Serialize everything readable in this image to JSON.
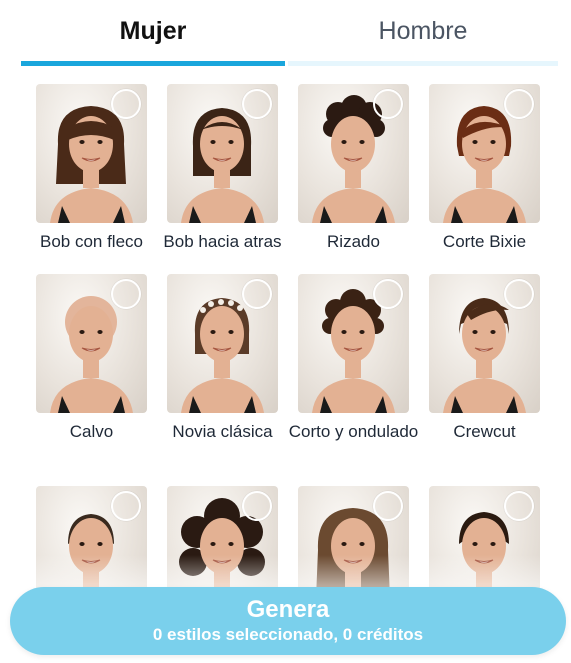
{
  "tabs": {
    "women": "Mujer",
    "men": "Hombre",
    "active": "women"
  },
  "styles": [
    {
      "label": "Bob con fleco",
      "icon": "bob-bangs-portrait",
      "hair": "#4a2a18",
      "selected": false
    },
    {
      "label": "Bob hacia atras",
      "icon": "slicked-bob-portrait",
      "hair": "#3b2416",
      "selected": false
    },
    {
      "label": "Rizado",
      "icon": "curly-portrait",
      "hair": "#2b1a12",
      "selected": false
    },
    {
      "label": "Corte Bixie",
      "icon": "bixie-portrait",
      "hair": "#6b2d14",
      "selected": false
    },
    {
      "label": "Calvo",
      "icon": "bald-portrait",
      "hair": "#e3b59b",
      "selected": false
    },
    {
      "label": "Novia clásica",
      "icon": "bridal-portrait",
      "hair": "#5a3b28",
      "selected": false
    },
    {
      "label": "Corto y ondulado",
      "icon": "short-wavy-portrait",
      "hair": "#3a2214",
      "selected": false
    },
    {
      "label": "Crewcut",
      "icon": "crewcut-portrait",
      "hair": "#4a2b18",
      "selected": false
    },
    {
      "label": "",
      "icon": "buzzcut-portrait",
      "hair": "#3a2a1e",
      "selected": false
    },
    {
      "label": "",
      "icon": "big-curls-portrait",
      "hair": "#2a1a12",
      "selected": false
    },
    {
      "label": "",
      "icon": "long-waves-portrait",
      "hair": "#6b4a30",
      "selected": false
    },
    {
      "label": "",
      "icon": "slick-back-portrait",
      "hair": "#2a1a10",
      "selected": false
    }
  ],
  "generate": {
    "title": "Genera",
    "subtitle": "0 estilos seleccionado, 0 créditos"
  },
  "colors": {
    "accent": "#1aa6dc",
    "button": "#7ad0ec",
    "skin": "#e3b193"
  }
}
